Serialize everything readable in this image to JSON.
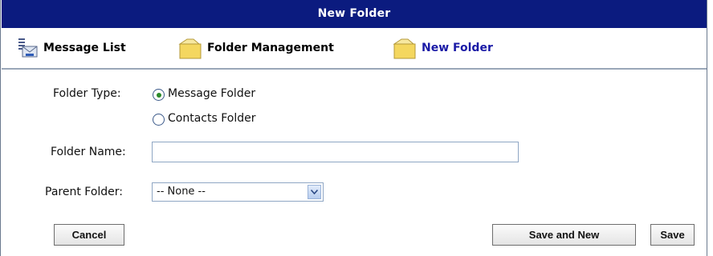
{
  "window": {
    "title": "New Folder"
  },
  "breadcrumb": {
    "items": [
      {
        "label": "Message List",
        "icon": "message-list-icon"
      },
      {
        "label": "Folder Management",
        "icon": "folder-icon"
      },
      {
        "label": "New Folder",
        "icon": "folder-icon"
      }
    ]
  },
  "form": {
    "folder_type": {
      "label": "Folder Type:",
      "options": [
        "Message Folder",
        "Contacts Folder"
      ],
      "selected": "Message Folder"
    },
    "folder_name": {
      "label": "Folder Name:",
      "value": ""
    },
    "parent_folder": {
      "label": "Parent Folder:",
      "selected": "-- None --"
    }
  },
  "buttons": {
    "cancel": "Cancel",
    "save_and_new": "Save and New",
    "save": "Save"
  },
  "colors": {
    "title_bar": "#0b1b7f",
    "current_crumb": "#1a1aa6",
    "radio_dot": "#2a8a2a"
  }
}
